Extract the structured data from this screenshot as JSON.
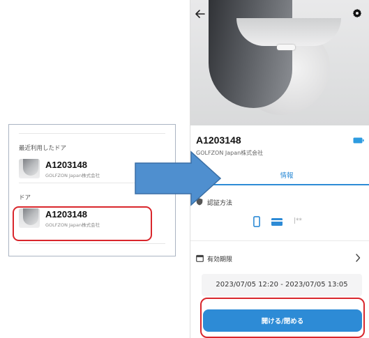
{
  "left_panel": {
    "recent_section": "最近利用したドア",
    "door_section": "ドア",
    "recent_items": [
      {
        "title": "A1203148",
        "subtitle": "GOLFZON Japan株式会社"
      }
    ],
    "door_items": [
      {
        "title": "A1203148",
        "subtitle": "GOLFZON Japan株式会社"
      }
    ]
  },
  "detail": {
    "title": "A1203148",
    "subtitle": "GOLFZON Japan株式会社",
    "tab_info": "情報",
    "auth_label": "認証方法",
    "pin_mask": "|**",
    "validity_label": "有効期限",
    "validity_range": "2023/07/05 12:20 - 2023/07/05 13:05",
    "open_close_button": "開ける/閉める"
  },
  "colors": {
    "accent": "#2d8bd6",
    "highlight": "#d9262c",
    "arrow": "#4f8fcf",
    "battery": "#2d9be0"
  },
  "icons": [
    "back-arrow-icon",
    "gear-icon",
    "battery-icon",
    "shield-icon",
    "smartphone-icon",
    "card-icon",
    "calendar-icon",
    "chevron-right-icon"
  ]
}
